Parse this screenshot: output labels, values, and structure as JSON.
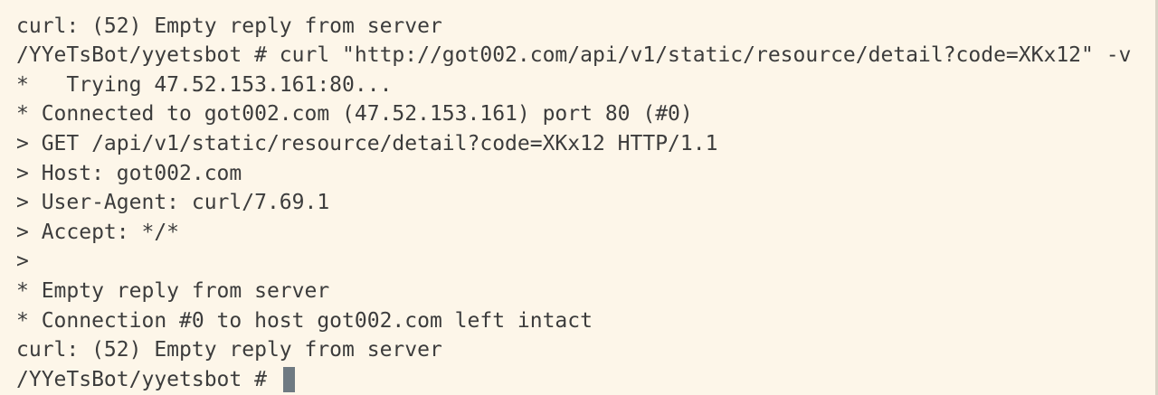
{
  "terminal": {
    "lines": [
      "curl: (52) Empty reply from server",
      "/YYeTsBot/yyetsbot # curl \"http://got002.com/api/v1/static/resource/detail?code=XKx12\" -v",
      "*   Trying 47.52.153.161:80...",
      "* Connected to got002.com (47.52.153.161) port 80 (#0)",
      "> GET /api/v1/static/resource/detail?code=XKx12 HTTP/1.1",
      "> Host: got002.com",
      "> User-Agent: curl/7.69.1",
      "> Accept: */*",
      ">",
      "* Empty reply from server",
      "* Connection #0 to host got002.com left intact",
      "curl: (52) Empty reply from server"
    ],
    "prompt": "/YYeTsBot/yyetsbot # "
  },
  "colors": {
    "background": "#fdf6e9",
    "text": "#3c3c3c",
    "cursor": "#6f7a82"
  }
}
